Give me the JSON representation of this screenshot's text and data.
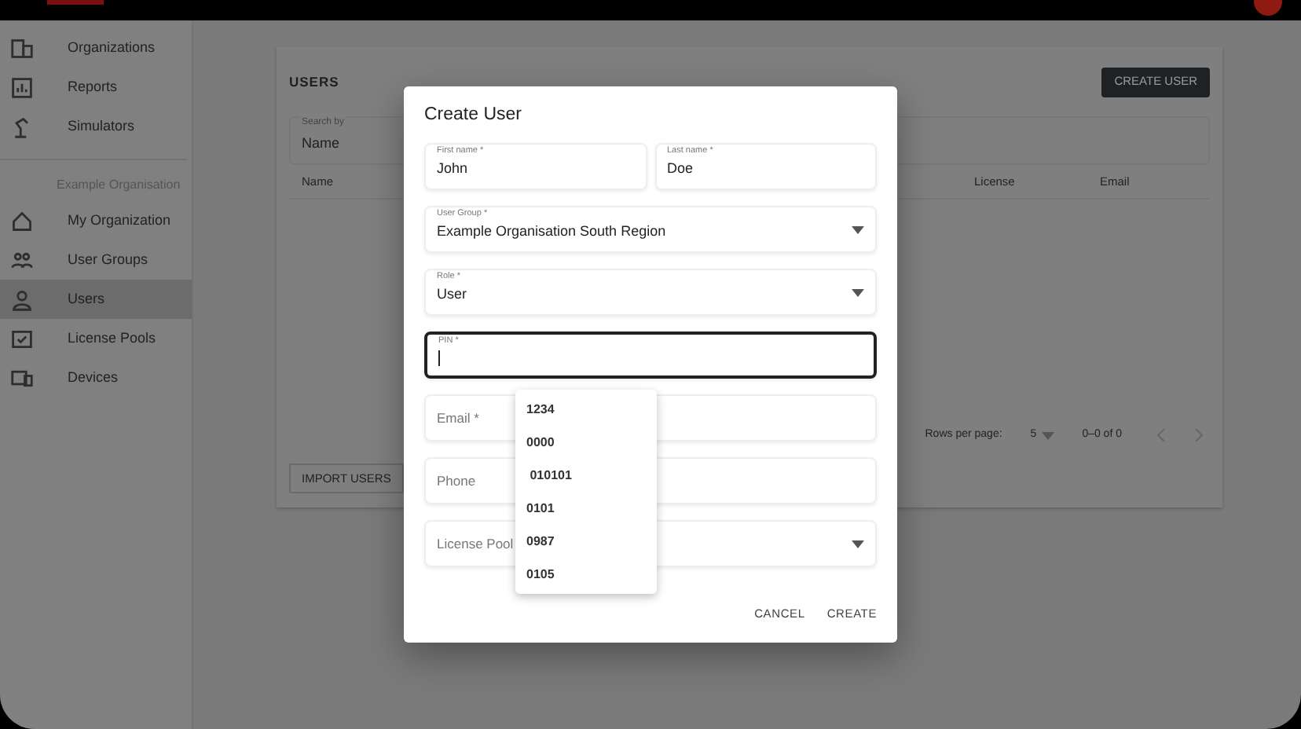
{
  "sidebar": {
    "items": [
      {
        "label": "Organizations",
        "selected": false
      },
      {
        "label": "Reports",
        "selected": false
      },
      {
        "label": "Simulators",
        "selected": false
      }
    ],
    "section_title": "Example Organisation",
    "org_items": [
      {
        "label": "My Organization",
        "selected": false
      },
      {
        "label": "User Groups",
        "selected": false
      },
      {
        "label": "Users",
        "selected": true
      },
      {
        "label": "License Pools",
        "selected": false
      },
      {
        "label": "Devices",
        "selected": false
      }
    ]
  },
  "users_panel": {
    "title": "USERS",
    "create_button": "CREATE USER",
    "search": {
      "label": "Search by",
      "value": "Name"
    },
    "columns": [
      "Name",
      "License",
      "Email"
    ],
    "pagination": {
      "rows_label": "Rows per page:",
      "rows_value": "5",
      "range": "0–0 of 0"
    },
    "import_button": "IMPORT USERS"
  },
  "dialog": {
    "title": "Create User",
    "fields": [
      {
        "kind": "text",
        "label": "First name *",
        "value": "John",
        "focused": false
      },
      {
        "kind": "text",
        "label": "Last name *",
        "value": "Doe",
        "focused": false
      },
      {
        "kind": "select",
        "label": "User Group *",
        "value": "Example Organisation South Region",
        "focused": false
      },
      {
        "kind": "select",
        "label": "Role *",
        "value": "User",
        "focused": false
      },
      {
        "kind": "text",
        "label": "PIN *",
        "focused": true
      },
      {
        "kind": "text",
        "placeholder": "Email *",
        "focused": false
      },
      {
        "kind": "text",
        "placeholder": "Phone",
        "focused": false
      },
      {
        "kind": "select",
        "placeholder": "License Pool",
        "focused": false
      }
    ],
    "suggestions": [
      "1234",
      "0000",
      " 010101",
      "0101",
      "0987",
      "0105"
    ],
    "buttons": [
      "CANCEL",
      "CREATE"
    ]
  }
}
